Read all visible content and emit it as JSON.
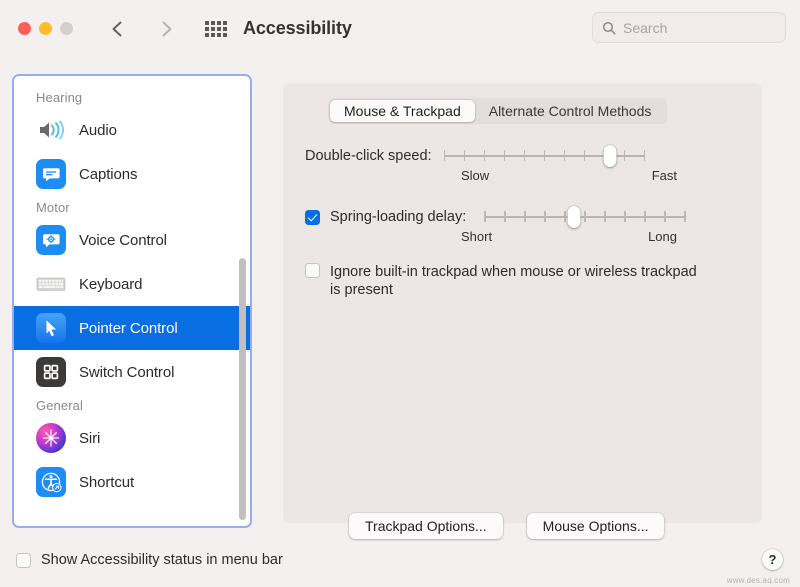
{
  "window": {
    "title": "Accessibility",
    "traffic_lights": [
      "close-red",
      "minimize-yellow",
      "zoom-gray"
    ],
    "nav": {
      "back_icon": "chevron-left-icon",
      "forward_icon": "chevron-right-icon"
    },
    "grid_icon": "show-all-grid-icon"
  },
  "search": {
    "placeholder": "Search",
    "value": "",
    "icon": "search-icon"
  },
  "sidebar": {
    "sections": [
      {
        "label": "Hearing",
        "items": [
          {
            "label": "Audio",
            "icon": "speaker-audio-icon",
            "selected": false
          },
          {
            "label": "Captions",
            "icon": "captions-bubble-icon",
            "selected": false
          }
        ]
      },
      {
        "label": "Motor",
        "items": [
          {
            "label": "Voice Control",
            "icon": "voice-control-icon",
            "selected": false
          },
          {
            "label": "Keyboard",
            "icon": "keyboard-icon",
            "selected": false
          },
          {
            "label": "Pointer Control",
            "icon": "pointer-cursor-icon",
            "selected": true
          },
          {
            "label": "Switch Control",
            "icon": "switch-control-grid-icon",
            "selected": false
          }
        ]
      },
      {
        "label": "General",
        "items": [
          {
            "label": "Siri",
            "icon": "siri-orb-icon",
            "selected": false
          },
          {
            "label": "Shortcut",
            "icon": "accessibility-shortcut-icon",
            "selected": false
          }
        ]
      }
    ],
    "scrollbar": "sidebar-scrollbar"
  },
  "pane": {
    "tabs": [
      {
        "label": "Mouse & Trackpad",
        "active": true
      },
      {
        "label": "Alternate Control Methods",
        "active": false
      }
    ],
    "double_click": {
      "label": "Double-click speed:",
      "min_label": "Slow",
      "max_label": "Fast",
      "value_percent": 83,
      "ticks": 11
    },
    "spring_loading": {
      "label": "Spring-loading delay:",
      "checked": true,
      "min_label": "Short",
      "max_label": "Long",
      "value_percent": 45,
      "ticks": 11
    },
    "ignore_trackpad": {
      "label": "Ignore built-in trackpad when mouse or wireless trackpad is present",
      "checked": false
    },
    "buttons": [
      {
        "label": "Trackpad Options..."
      },
      {
        "label": "Mouse Options..."
      }
    ]
  },
  "footer": {
    "show_status": {
      "label": "Show Accessibility status in menu bar",
      "checked": false
    },
    "help_label": "?",
    "watermark": "www.des.aq.com"
  }
}
